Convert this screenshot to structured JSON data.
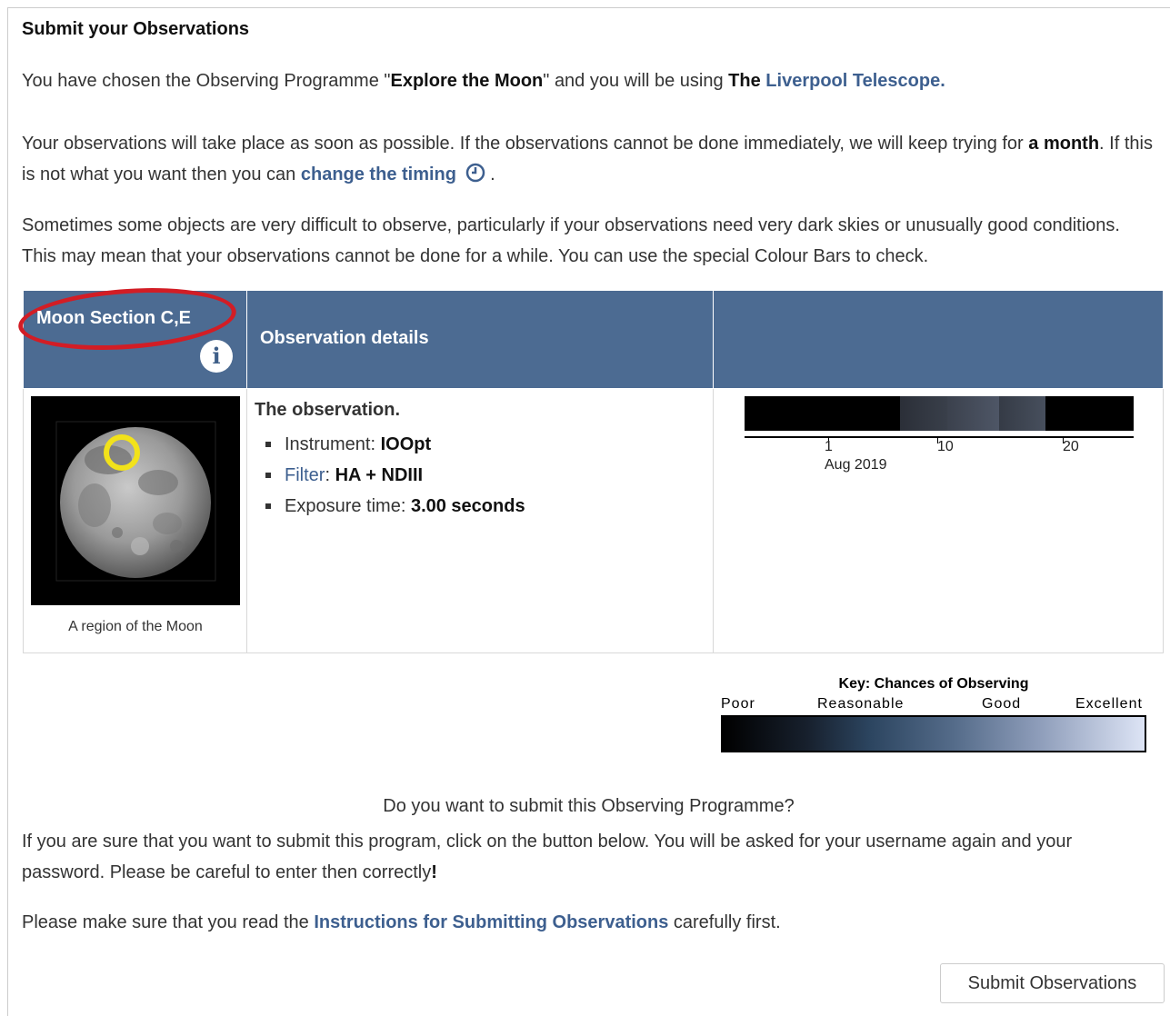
{
  "heading": "Submit your Observations",
  "intro": {
    "p1": "You have chosen the Observing Programme \"",
    "programme": "Explore the Moon",
    "p2": "\" and you will be using ",
    "the": "The",
    "telescope": "Liverpool Telescope",
    "end": "."
  },
  "timing": {
    "p1": "Your observations will take place as soon as possible. If the observations cannot be done immediately, we will keep trying for ",
    "duration": "a month",
    "p2": ". If this is not what you want then you can ",
    "link": "change the timing",
    "end": "."
  },
  "difficulty_text": "Sometimes some objects are very difficult to observe, particularly if your observations need very dark skies or unusually good conditions. This may mean that your observations cannot be done for a while. You can use the special Colour Bars to check.",
  "table": {
    "target_title": "Moon Section C,E",
    "details_heading": "Observation details",
    "image_caption": "A region of the Moon",
    "details_title": "The observation.",
    "instrument_label": "Instrument: ",
    "instrument_value": "IOOpt",
    "filter_label": "Filter",
    "filter_sep": ": ",
    "filter_value": "HA + NDIII",
    "exposure_label": "Exposure time: ",
    "exposure_value": "3.00 seconds"
  },
  "timeline": {
    "ticks": [
      "1",
      "10",
      "20"
    ],
    "month": "Aug 2019",
    "chance_bands": [
      {
        "day_start": 1,
        "day_end": 9.5,
        "level": 0
      },
      {
        "day_start": 9.5,
        "day_end": 14,
        "level": 0.4
      },
      {
        "day_start": 14,
        "day_end": 19,
        "level": 0.55
      },
      {
        "day_start": 19,
        "day_end": 23.5,
        "level": 0.5
      },
      {
        "day_start": 23.5,
        "day_end": 32,
        "level": 0
      }
    ]
  },
  "key": {
    "title": "Key: Chances of Observing",
    "labels": [
      "Poor",
      "Reasonable",
      "Good",
      "Excellent"
    ]
  },
  "submit": {
    "question": "Do you want to submit this Observing Programme?",
    "confirm_p1": "If you are sure that you want to submit this program, click on the button below. You will be asked for your username again and your password. Please be careful to enter then correctly",
    "confirm_bang": "!",
    "read_p1": "Please make sure that you read the ",
    "read_link": "Instructions for Submitting Observations",
    "read_p2": " carefully first.",
    "button": "Submit Observations"
  },
  "colors": {
    "header_bg": "#4c6b92",
    "link": "#3d5f8f",
    "highlight_ring": "#d21d25",
    "target_marker": "#f2e21a"
  }
}
